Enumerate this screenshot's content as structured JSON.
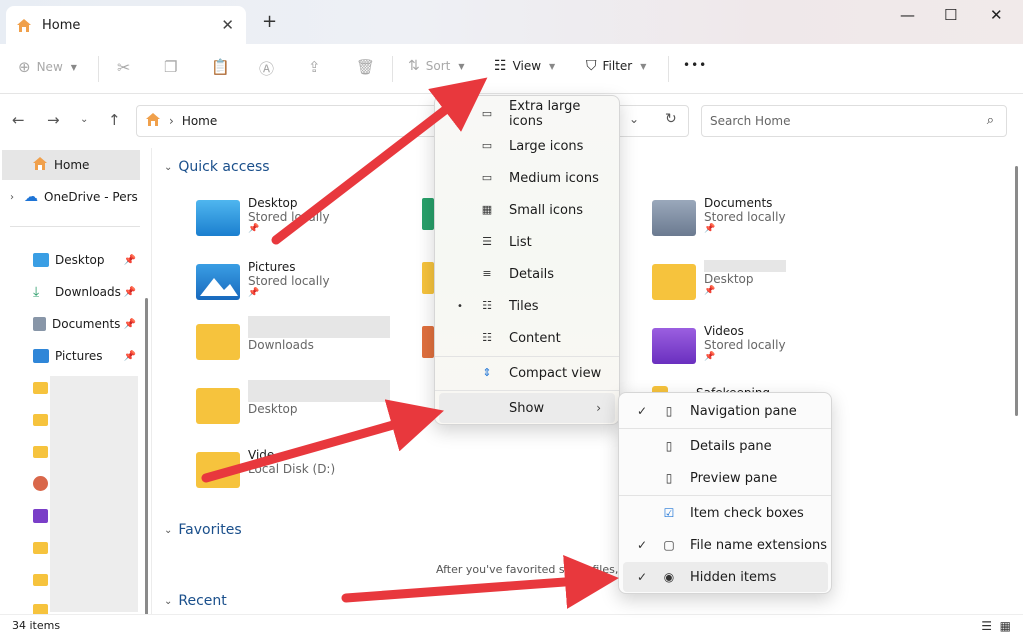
{
  "window": {
    "tab_title": "Home",
    "new_tab_label": "+",
    "minimize": "—",
    "maximize": "☐",
    "close": "✕"
  },
  "commandbar": {
    "new_label": "New",
    "sort_label": "Sort",
    "view_label": "View",
    "filter_label": "Filter",
    "more_label": "•••"
  },
  "address": {
    "path": "Home",
    "search_placeholder": "Search Home"
  },
  "sidebar": {
    "home": "Home",
    "onedrive": "OneDrive - Pers",
    "desktop": "Desktop",
    "downloads": "Downloads",
    "documents": "Documents",
    "pictures": "Pictures"
  },
  "content": {
    "quick_access": "Quick access",
    "favorites": "Favorites",
    "recent": "Recent",
    "favorites_empty": "After you've favorited some files, w",
    "tiles": {
      "desktop": {
        "name": "Desktop",
        "sub": "Stored locally"
      },
      "pictures": {
        "name": "Pictures",
        "sub": "Stored locally"
      },
      "downloads_row": {
        "sub": "Downloads"
      },
      "desktop_row": {
        "sub": "Desktop"
      },
      "videos_d": {
        "name": "Vide",
        "sub": "Local Disk (D:)"
      },
      "documents": {
        "name": "Documents",
        "sub": "Stored locally"
      },
      "desk_sub": {
        "sub": "Desktop"
      },
      "videos": {
        "name": "Videos",
        "sub": "Stored locally"
      },
      "safekeeping": {
        "name": "Safekeeping"
      }
    }
  },
  "view_menu": {
    "items": [
      {
        "label": "Extra large icons",
        "icon": "▭"
      },
      {
        "label": "Large icons",
        "icon": "▭"
      },
      {
        "label": "Medium icons",
        "icon": "▭"
      },
      {
        "label": "Small icons",
        "icon": "▦"
      },
      {
        "label": "List",
        "icon": "☰"
      },
      {
        "label": "Details",
        "icon": "≡"
      },
      {
        "label": "Tiles",
        "icon": "☷"
      },
      {
        "label": "Content",
        "icon": "☷"
      },
      {
        "label": "Compact view",
        "icon": "⇕"
      },
      {
        "label": "Show",
        "icon": ""
      }
    ],
    "selected_bullet": "•",
    "submenu_arrow": "›"
  },
  "show_menu": {
    "items": [
      {
        "label": "Navigation pane",
        "icon": "▯",
        "check": "✓"
      },
      {
        "label": "Details pane",
        "icon": "▯",
        "check": ""
      },
      {
        "label": "Preview pane",
        "icon": "▯",
        "check": ""
      },
      {
        "label": "Item check boxes",
        "icon": "☑",
        "check": ""
      },
      {
        "label": "File name extensions",
        "icon": "▢",
        "check": "✓"
      },
      {
        "label": "Hidden items",
        "icon": "◉",
        "check": "✓"
      }
    ]
  },
  "status": {
    "items_count": "34 items"
  },
  "colors": {
    "arrow": "#e8383d",
    "folder": "#f6c33d",
    "accent": "#1a4f8b"
  }
}
